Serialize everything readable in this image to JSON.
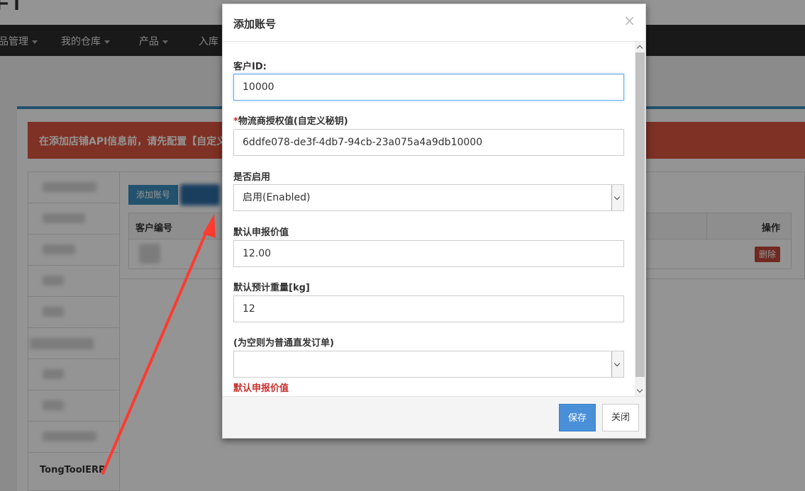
{
  "background": {
    "brand_fragment": "FT",
    "nav": [
      {
        "label": "品管理"
      },
      {
        "label": "我的仓库"
      },
      {
        "label": "产品"
      },
      {
        "label": "入库"
      }
    ],
    "alert_text": "在添加店铺API信息前，请先配置【自定义",
    "sidebar_last_item": "TongToolERP",
    "add_button": "添加账号",
    "table_headers": {
      "customer_no": "客户编号",
      "actions": "操作"
    },
    "delete_button": "删除"
  },
  "modal": {
    "title": "添加账号",
    "close_glyph": "×",
    "fields": {
      "customer_id": {
        "label": "客户ID:",
        "value": "10000"
      },
      "auth_key": {
        "required_mark": "*",
        "label": "物流商授权值(自定义秘钥)",
        "value": "6ddfe078-de3f-4db7-94cb-23a075a4a9db10000"
      },
      "enabled": {
        "label": "是否启用",
        "value": "启用(Enabled)"
      },
      "declared_value": {
        "label": "默认申报价值",
        "value": "12.00"
      },
      "weight": {
        "label": "默认预计重量[kg]",
        "value": "12"
      },
      "order_type": {
        "label": "(为空则为普通直发订单)",
        "value": ""
      }
    },
    "error_text": "默认申报价值",
    "save_button": "保存",
    "close_button": "关闭"
  },
  "colors": {
    "primary": "#4a90d9",
    "danger": "#c9302c",
    "alert_bg": "#d9553f",
    "annotation_arrow": "#ff3b30"
  }
}
